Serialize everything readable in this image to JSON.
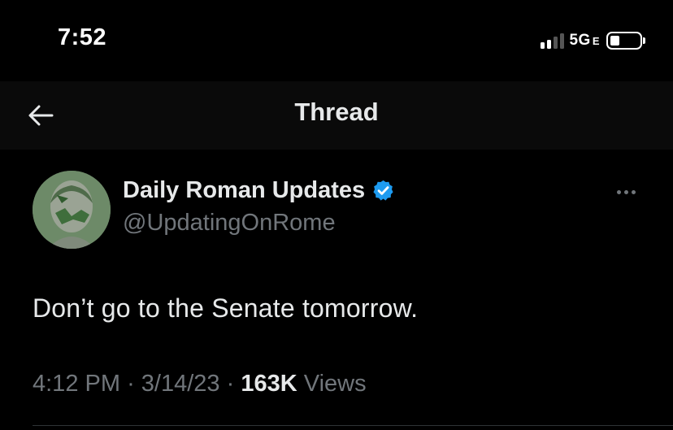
{
  "status_bar": {
    "time": "7:52",
    "network": "5G",
    "network_suffix": "E",
    "signal_bars_active": 2,
    "signal_bars_total": 4
  },
  "header": {
    "title": "Thread",
    "back_icon": "arrow-left-icon"
  },
  "tweet": {
    "display_name": "Daily Roman Updates",
    "handle": "@UpdatingOnRome",
    "verified": true,
    "text": "Don’t go to the Senate tomorrow.",
    "time": "4:12 PM",
    "date": "3/14/23",
    "separator": "·",
    "views_count": "163K",
    "views_label": "Views"
  },
  "colors": {
    "background": "#000000",
    "header_background": "#0a0a0a",
    "primary_text": "#e7e9ea",
    "secondary_text": "#71767b",
    "verified_blue": "#1d9bf0",
    "divider": "#2f3336"
  }
}
